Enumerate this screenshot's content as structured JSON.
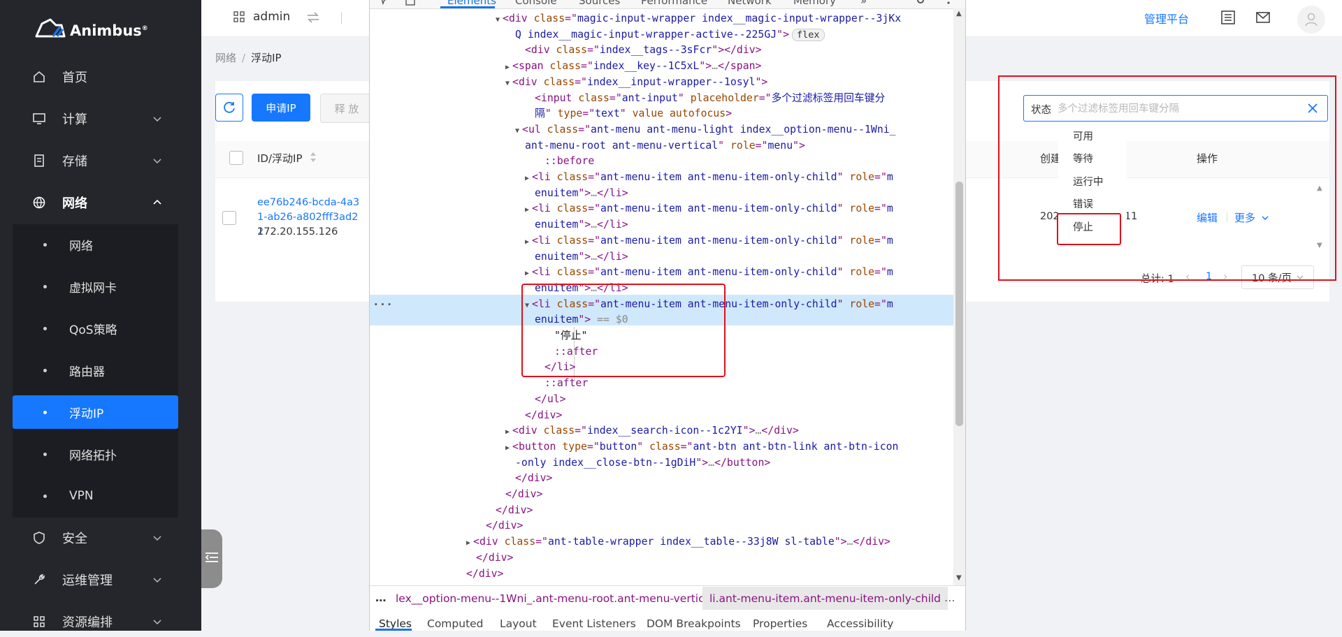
{
  "app": {
    "logo_text": "Animbus",
    "logo_mark": "®",
    "accent_color": "#1677ff",
    "sidebar_bg": "#25262c"
  },
  "sidebar": {
    "items": [
      {
        "label": "首页",
        "icon": "home-icon"
      },
      {
        "label": "计算",
        "icon": "monitor-icon"
      },
      {
        "label": "存储",
        "icon": "storage-icon"
      },
      {
        "label": "网络",
        "icon": "globe-icon"
      },
      {
        "label": "安全",
        "icon": "shield-icon"
      },
      {
        "label": "运维管理",
        "icon": "wrench-icon"
      },
      {
        "label": "资源编排",
        "icon": "grid-icon"
      }
    ],
    "network_sub": [
      {
        "label": "网络"
      },
      {
        "label": "虚拟网卡"
      },
      {
        "label": "QoS策略"
      },
      {
        "label": "路由器"
      },
      {
        "label": "浮动IP"
      },
      {
        "label": "网络拓扑"
      },
      {
        "label": "VPN"
      }
    ]
  },
  "header": {
    "project": "admin",
    "admin_link": "管理平台"
  },
  "breadcrumb": [
    "网络",
    "浮动IP"
  ],
  "toolbar": {
    "apply_label": "申请IP",
    "release_label": "释 放"
  },
  "filter": {
    "tag": "状态",
    "placeholder": "多个过滤标签用回车键分隔",
    "options": [
      "可用",
      "等待",
      "运行中",
      "错误",
      "停止"
    ]
  },
  "table": {
    "headers": {
      "id": "ID/浮动IP",
      "created": "创建",
      "ops": "操作"
    },
    "rows": [
      {
        "id": "ee76b246-bcda-4a31-ab26-a802fff3ad22",
        "ip": "172.20.155.126",
        "created_prefix": "202",
        "created_suffix": ":11",
        "edit": "编辑",
        "more": "更多"
      }
    ]
  },
  "pager": {
    "total_label": "总计: 1",
    "current": "1",
    "size_label": "10 条/页"
  },
  "devtools": {
    "tabs": [
      "Elements",
      "Console",
      "Sources",
      "Performance",
      "Network",
      "Memory",
      "»"
    ],
    "active_tab": "Elements",
    "lines": [
      {
        "indent": 194,
        "tri": "▼",
        "parts": [
          [
            "t",
            "<div "
          ],
          [
            "an",
            "class"
          ],
          [
            "t",
            "=\""
          ],
          [
            "av",
            "magic-input-wrapper index__magic-input-wrapper--3jKx"
          ]
        ]
      },
      {
        "indent": 208,
        "parts": [
          [
            "av",
            "Q index__magic-input-wrapper-active--225GJ"
          ],
          [
            "t",
            "\">"
          ]
        ],
        "badge": "flex"
      },
      {
        "indent": 222,
        "parts": [
          [
            "t",
            "<div "
          ],
          [
            "an",
            "class"
          ],
          [
            "t",
            "=\""
          ],
          [
            "av",
            "index__tags--3sFcr"
          ],
          [
            "t",
            "\"></div>"
          ]
        ]
      },
      {
        "indent": 208,
        "tri": "▶",
        "parts": [
          [
            "t",
            "<span "
          ],
          [
            "an",
            "class"
          ],
          [
            "t",
            "=\""
          ],
          [
            "av",
            "index__key--1C5xL"
          ],
          [
            "t",
            "\">"
          ],
          [
            "gr",
            "…"
          ],
          [
            "t",
            "</span>"
          ]
        ]
      },
      {
        "indent": 208,
        "tri": "▼",
        "parts": [
          [
            "t",
            "<div "
          ],
          [
            "an",
            "class"
          ],
          [
            "t",
            "=\""
          ],
          [
            "av",
            "index__input-wrapper--1osyl"
          ],
          [
            "t",
            "\">"
          ]
        ]
      },
      {
        "indent": 236,
        "parts": [
          [
            "t",
            "<input "
          ],
          [
            "an",
            "class"
          ],
          [
            "t",
            "=\""
          ],
          [
            "av",
            "ant-input"
          ],
          [
            "t",
            "\" "
          ],
          [
            "an",
            "placeholder"
          ],
          [
            "t",
            "=\""
          ],
          [
            "av",
            "多个过滤标签用回车键分"
          ]
        ]
      },
      {
        "indent": 236,
        "parts": [
          [
            "av",
            "隔"
          ],
          [
            "t",
            "\" "
          ],
          [
            "an",
            "type"
          ],
          [
            "t",
            "=\""
          ],
          [
            "av",
            "text"
          ],
          [
            "t",
            "\" "
          ],
          [
            "an",
            "value autofocus"
          ],
          [
            "t",
            ">"
          ]
        ]
      },
      {
        "indent": 222,
        "tri": "▼",
        "parts": [
          [
            "t",
            "<ul "
          ],
          [
            "an",
            "class"
          ],
          [
            "t",
            "=\""
          ],
          [
            "av",
            "ant-menu ant-menu-light index__option-menu--1Wni_"
          ]
        ]
      },
      {
        "indent": 222,
        "parts": [
          [
            "av",
            "ant-menu-root ant-menu-vertical"
          ],
          [
            "t",
            "\" "
          ],
          [
            "an",
            "role"
          ],
          [
            "t",
            "=\""
          ],
          [
            "av",
            "menu"
          ],
          [
            "t",
            "\">"
          ]
        ]
      },
      {
        "indent": 250,
        "parts": [
          [
            "ps",
            "::before"
          ]
        ]
      },
      {
        "indent": 236,
        "tri": "▶",
        "parts": [
          [
            "t",
            "<li "
          ],
          [
            "an",
            "class"
          ],
          [
            "t",
            "=\""
          ],
          [
            "av",
            "ant-menu-item ant-menu-item-only-child"
          ],
          [
            "t",
            "\" "
          ],
          [
            "an",
            "role"
          ],
          [
            "t",
            "=\""
          ],
          [
            "av",
            "m"
          ]
        ]
      },
      {
        "indent": 236,
        "parts": [
          [
            "av",
            "enuitem"
          ],
          [
            "t",
            "\">"
          ],
          [
            "gr",
            "…"
          ],
          [
            "t",
            "</li>"
          ]
        ]
      },
      {
        "indent": 236,
        "tri": "▶",
        "parts": [
          [
            "t",
            "<li "
          ],
          [
            "an",
            "class"
          ],
          [
            "t",
            "=\""
          ],
          [
            "av",
            "ant-menu-item ant-menu-item-only-child"
          ],
          [
            "t",
            "\" "
          ],
          [
            "an",
            "role"
          ],
          [
            "t",
            "=\""
          ],
          [
            "av",
            "m"
          ]
        ]
      },
      {
        "indent": 236,
        "parts": [
          [
            "av",
            "enuitem"
          ],
          [
            "t",
            "\">"
          ],
          [
            "gr",
            "…"
          ],
          [
            "t",
            "</li>"
          ]
        ]
      },
      {
        "indent": 236,
        "tri": "▶",
        "parts": [
          [
            "t",
            "<li "
          ],
          [
            "an",
            "class"
          ],
          [
            "t",
            "=\""
          ],
          [
            "av",
            "ant-menu-item ant-menu-item-only-child"
          ],
          [
            "t",
            "\" "
          ],
          [
            "an",
            "role"
          ],
          [
            "t",
            "=\""
          ],
          [
            "av",
            "m"
          ]
        ]
      },
      {
        "indent": 236,
        "parts": [
          [
            "av",
            "enuitem"
          ],
          [
            "t",
            "\">"
          ],
          [
            "gr",
            "…"
          ],
          [
            "t",
            "</li>"
          ]
        ]
      },
      {
        "indent": 236,
        "tri": "▶",
        "parts": [
          [
            "t",
            "<li "
          ],
          [
            "an",
            "class"
          ],
          [
            "t",
            "=\""
          ],
          [
            "av",
            "ant-menu-item ant-menu-item-only-child"
          ],
          [
            "t",
            "\" "
          ],
          [
            "an",
            "role"
          ],
          [
            "t",
            "=\""
          ],
          [
            "av",
            "m"
          ]
        ]
      },
      {
        "indent": 236,
        "parts": [
          [
            "av",
            "enuitem"
          ],
          [
            "t",
            "\">"
          ],
          [
            "gr",
            "…"
          ],
          [
            "t",
            "</li>"
          ]
        ]
      },
      {
        "indent": 236,
        "tri": "▼",
        "parts": [
          [
            "t",
            "<li "
          ],
          [
            "an",
            "class"
          ],
          [
            "t",
            "=\""
          ],
          [
            "av",
            "ant-menu-item ant-menu-item-only-child"
          ],
          [
            "t",
            "\" "
          ],
          [
            "an",
            "role"
          ],
          [
            "t",
            "=\""
          ],
          [
            "av",
            "m"
          ]
        ]
      },
      {
        "indent": 236,
        "parts": [
          [
            "av",
            "enuitem"
          ],
          [
            "t",
            "\">"
          ],
          [
            "gr",
            " == $0"
          ]
        ]
      },
      {
        "indent": 264,
        "parts": [
          [
            "tx",
            "\"停止\""
          ]
        ]
      },
      {
        "indent": 264,
        "parts": [
          [
            "ps",
            "::after"
          ]
        ]
      },
      {
        "indent": 250,
        "parts": [
          [
            "t",
            "</li>"
          ]
        ]
      },
      {
        "indent": 250,
        "parts": [
          [
            "ps",
            "::after"
          ]
        ]
      },
      {
        "indent": 236,
        "parts": [
          [
            "t",
            "</ul>"
          ]
        ]
      },
      {
        "indent": 222,
        "parts": [
          [
            "t",
            "</div>"
          ]
        ]
      },
      {
        "indent": 208,
        "tri": "▶",
        "parts": [
          [
            "t",
            "<div "
          ],
          [
            "an",
            "class"
          ],
          [
            "t",
            "=\""
          ],
          [
            "av",
            "index__search-icon--1c2YI"
          ],
          [
            "t",
            "\">"
          ],
          [
            "gr",
            "…"
          ],
          [
            "t",
            "</div>"
          ]
        ]
      },
      {
        "indent": 208,
        "tri": "▶",
        "parts": [
          [
            "t",
            "<button "
          ],
          [
            "an",
            "type"
          ],
          [
            "t",
            "=\""
          ],
          [
            "av",
            "button"
          ],
          [
            "t",
            "\" "
          ],
          [
            "an",
            "class"
          ],
          [
            "t",
            "=\""
          ],
          [
            "av",
            "ant-btn ant-btn-link ant-btn-icon"
          ]
        ]
      },
      {
        "indent": 208,
        "parts": [
          [
            "av",
            "-only index__close-btn--1gDiH"
          ],
          [
            "t",
            "\">"
          ],
          [
            "gr",
            "…"
          ],
          [
            "t",
            "</button>"
          ]
        ]
      },
      {
        "indent": 208,
        "parts": [
          [
            "t",
            "</div>"
          ]
        ]
      },
      {
        "indent": 194,
        "parts": [
          [
            "t",
            "</div>"
          ]
        ]
      },
      {
        "indent": 180,
        "parts": [
          [
            "t",
            "</div>"
          ]
        ]
      },
      {
        "indent": 166,
        "parts": [
          [
            "t",
            "</div>"
          ]
        ]
      },
      {
        "indent": 152,
        "tri": "▶",
        "parts": [
          [
            "t",
            "<div "
          ],
          [
            "an",
            "class"
          ],
          [
            "t",
            "=\""
          ],
          [
            "av",
            "ant-table-wrapper index__table--33j8W sl-table"
          ],
          [
            "t",
            "\">"
          ],
          [
            "gr",
            "…"
          ],
          [
            "t",
            "</div>"
          ]
        ]
      },
      {
        "indent": 152,
        "parts": [
          [
            "t",
            "</div>"
          ]
        ]
      },
      {
        "indent": 138,
        "parts": [
          [
            "t",
            "</div>"
          ]
        ]
      }
    ],
    "breadcrumb": {
      "ellipsis": "…",
      "item1": "lex__option-menu--1Wni_.ant-menu-root.ant-menu-vertical",
      "item2": "li.ant-menu-item.ant-menu-item-only-child",
      "more": "…"
    },
    "subtabs": [
      "Styles",
      "Computed",
      "Layout",
      "Event Listeners",
      "DOM Breakpoints",
      "Properties",
      "Accessibility"
    ]
  }
}
